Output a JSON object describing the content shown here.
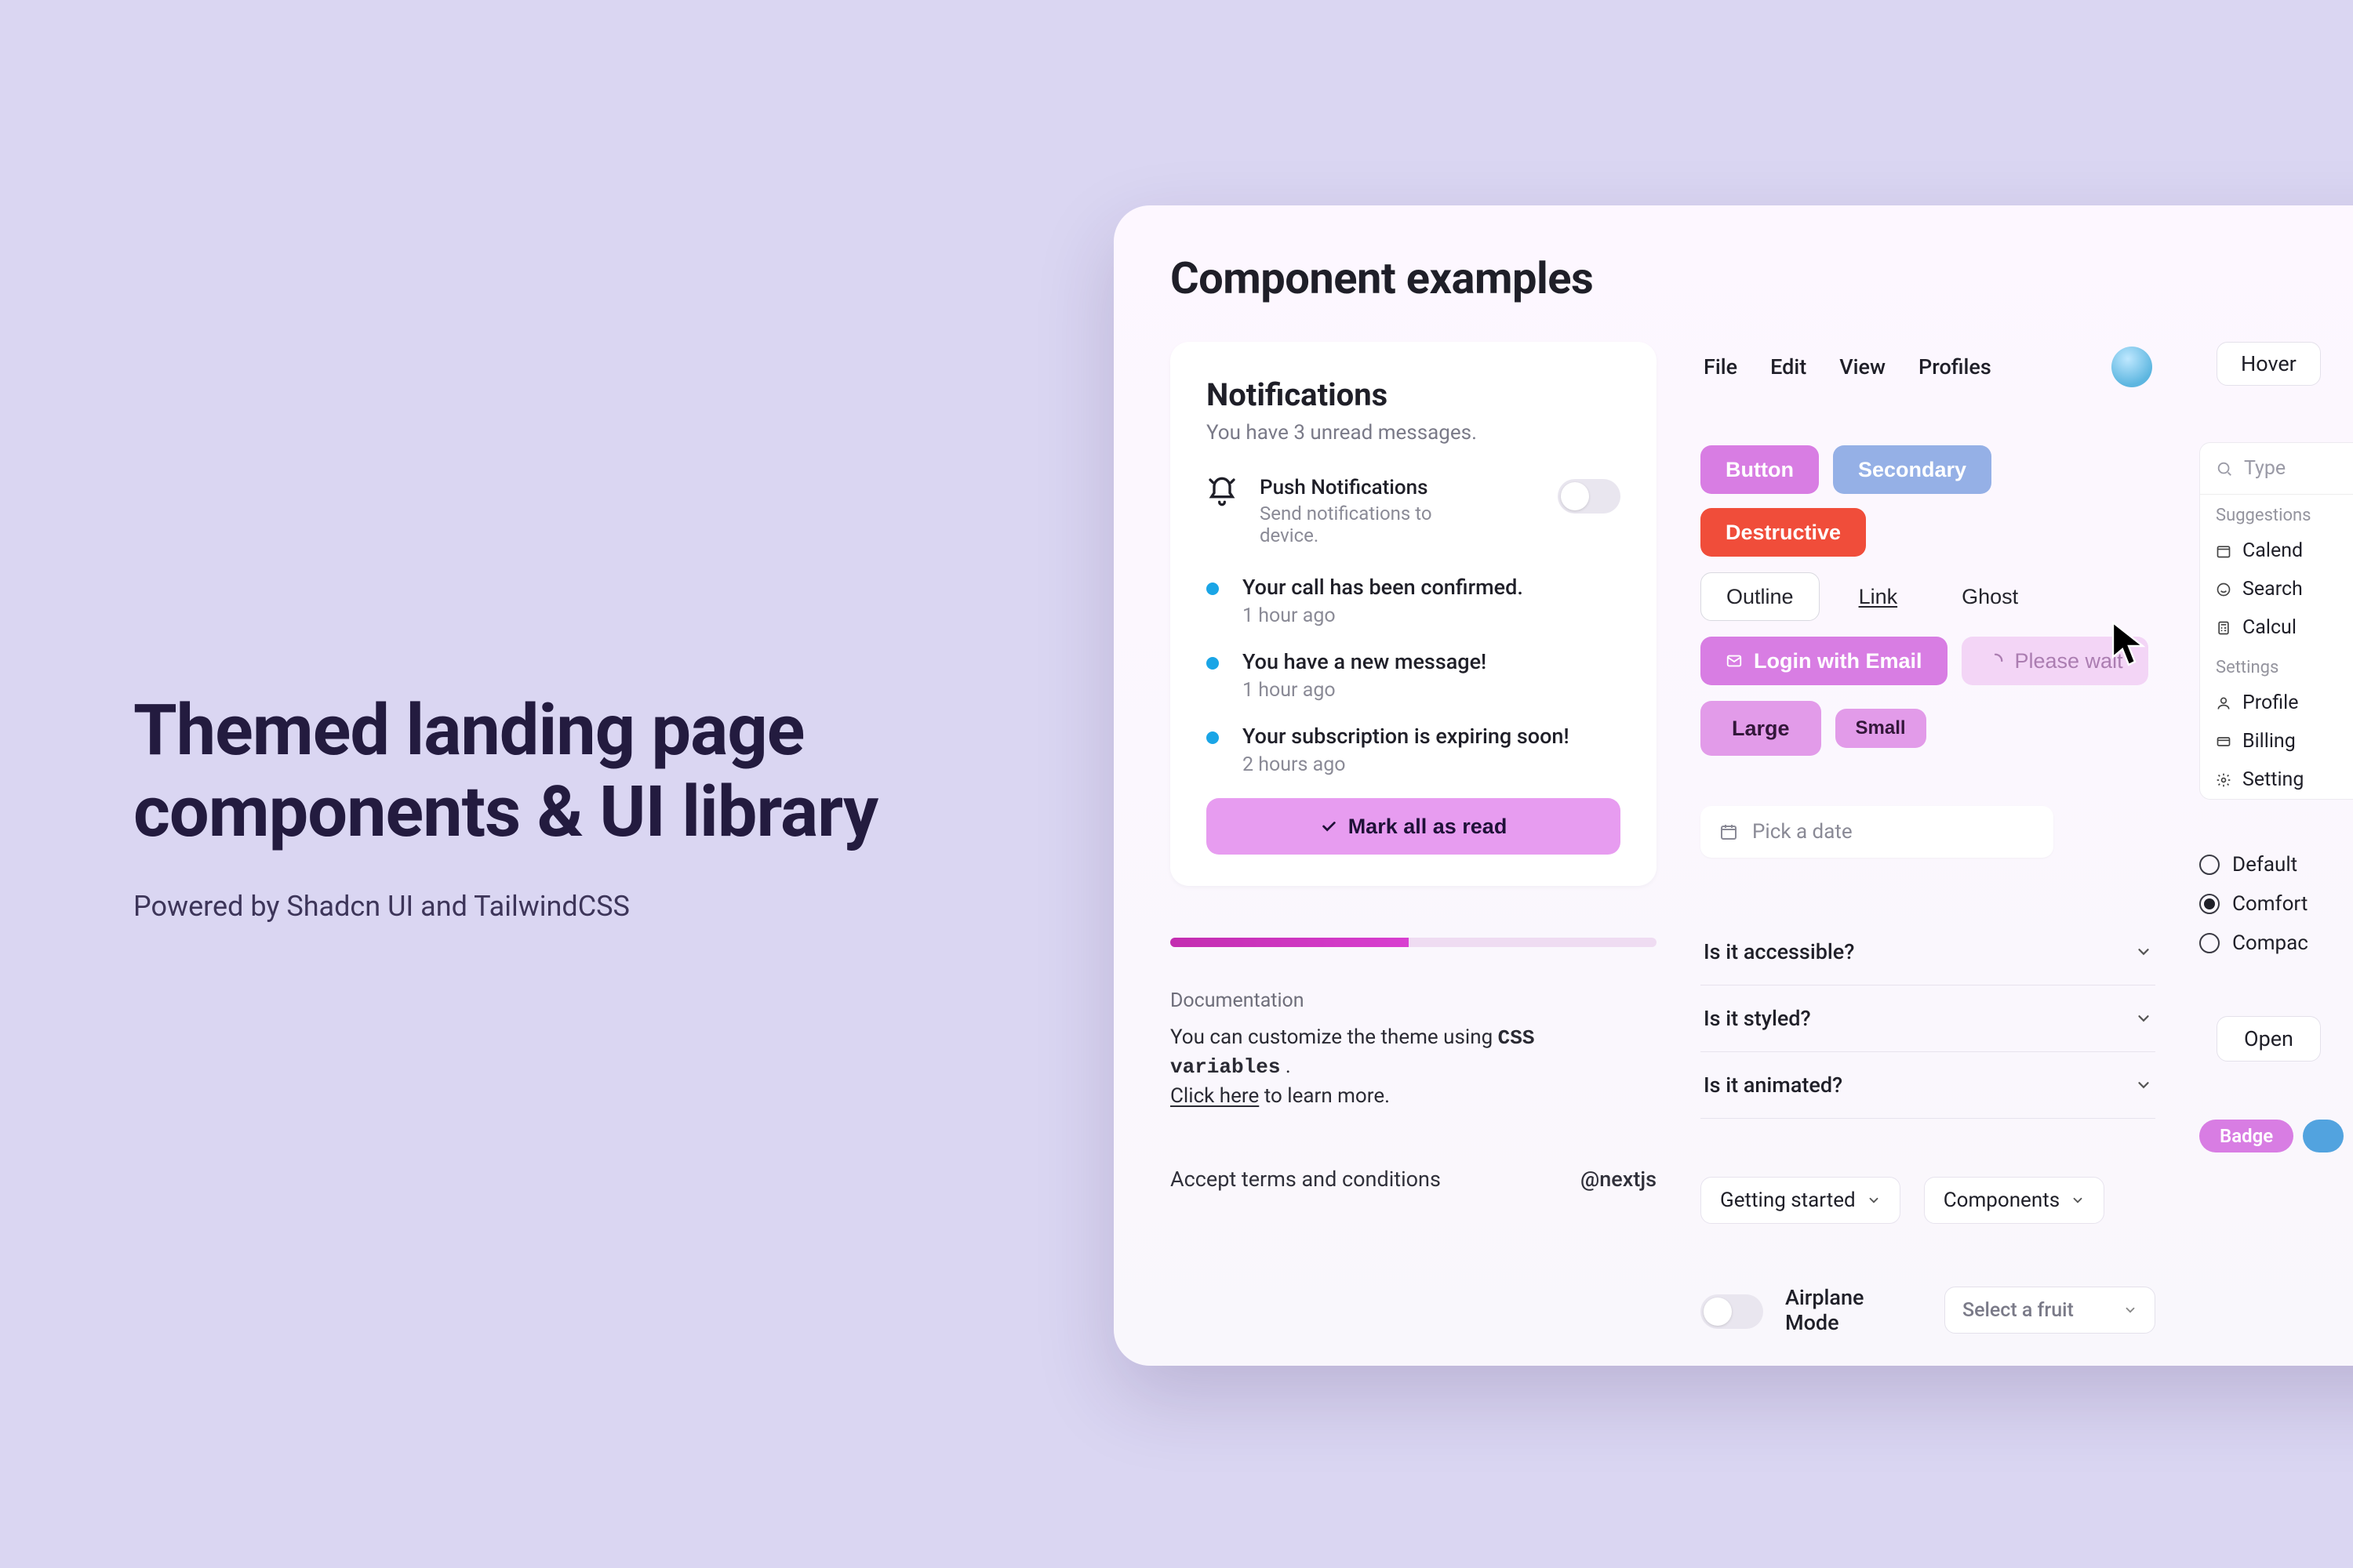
{
  "hero": {
    "title": "Themed landing page components & UI library",
    "subtitle": "Powered by Shadcn UI and TailwindCSS"
  },
  "panel": {
    "title": "Component examples",
    "notifications": {
      "heading": "Notifications",
      "subheading": "You have 3 unread messages.",
      "push": {
        "title": "Push Notifications",
        "sub": "Send notifications to device."
      },
      "items": [
        {
          "title": "Your call has been confirmed.",
          "time": "1 hour ago"
        },
        {
          "title": "You have a new message!",
          "time": "1 hour ago"
        },
        {
          "title": "Your subscription is expiring soon!",
          "time": "2 hours ago"
        }
      ],
      "mark_all": "Mark all as read"
    },
    "documentation": {
      "label": "Documentation",
      "line1_pre": "You can customize the theme using ",
      "code": "CSS variables",
      "line1_post": " .",
      "link_text": "Click here",
      "line2_post": " to learn more."
    },
    "terms": {
      "label": "Accept terms and conditions",
      "handle": "@nextjs"
    },
    "menubar": {
      "items": [
        "File",
        "Edit",
        "View",
        "Profiles"
      ]
    },
    "buttons": {
      "primary": "Button",
      "secondary": "Secondary",
      "destructive": "Destructive",
      "outline": "Outline",
      "link": "Link",
      "ghost": "Ghost",
      "login": "Login with Email",
      "wait": "Please wait",
      "large": "Large",
      "small": "Small"
    },
    "datepicker": {
      "placeholder": "Pick a date"
    },
    "accordion": [
      "Is it accessible?",
      "Is it styled?",
      "Is it animated?"
    ],
    "dropdowns": {
      "a": "Getting started",
      "b": "Components"
    },
    "airplane": {
      "label": "Airplane Mode"
    },
    "select": {
      "placeholder": "Select a fruit"
    },
    "right": {
      "hover": "Hover",
      "command": {
        "search_placeholder": "Type",
        "group_a": "Suggestions",
        "items_a": [
          "Calend",
          "Search",
          "Calcul"
        ],
        "group_b": "Settings",
        "items_b": [
          "Profile",
          "Billing",
          "Setting"
        ]
      },
      "radios": [
        "Default",
        "Comfort",
        "Compac"
      ],
      "open": "Open",
      "badge": "Badge"
    }
  }
}
